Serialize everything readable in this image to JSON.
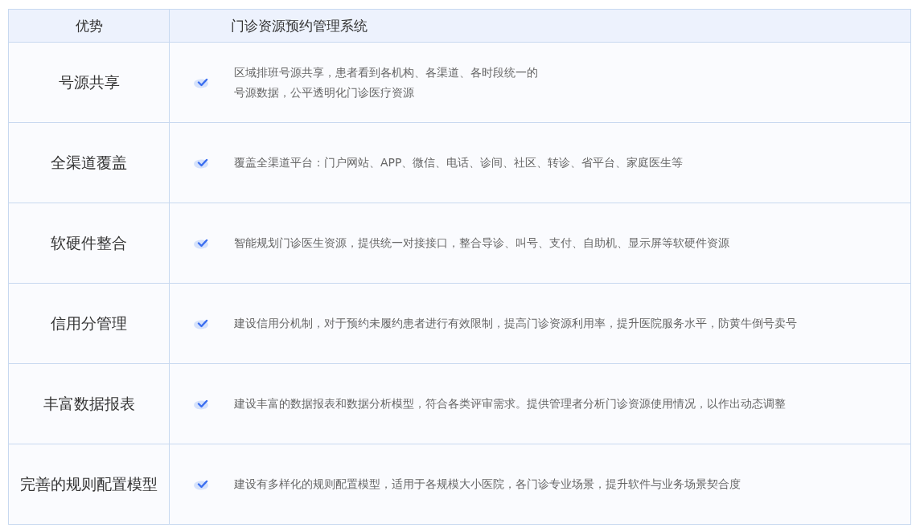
{
  "table": {
    "columns": [
      "优势",
      "门诊资源预约管理系统"
    ],
    "rows": [
      {
        "advantage": "号源共享",
        "lines": [
          "区域排班号源共享，患者看到各机构、各渠道、各时段统一的",
          "号源数据，公平透明化门诊医疗资源"
        ]
      },
      {
        "advantage": "全渠道覆盖",
        "lines": [
          "覆盖全渠道平台：门户网站、APP、微信、电话、诊间、社区、转诊、省平台、家庭医生等"
        ]
      },
      {
        "advantage": "软硬件整合",
        "lines": [
          "智能规划门诊医生资源，提供统一对接接口，整合导诊、叫号、支付、自助机、显示屏等软硬件资源"
        ]
      },
      {
        "advantage": "信用分管理",
        "lines": [
          "建设信用分机制，对于预约未履约患者进行有效限制，提高门诊资源利用率，提升医院服务水平，防黄牛倒号卖号"
        ]
      },
      {
        "advantage": "丰富数据报表",
        "lines": [
          "建设丰富的数据报表和数据分析模型，符合各类评审需求。提供管理者分析门诊资源使用情况，以作出动态调整"
        ]
      },
      {
        "advantage": "完善的规则配置模型",
        "lines": [
          "建设有多样化的规则配置模型，适用于各规模大小医院，各门诊专业场景，提升软件与业务场景契合度"
        ]
      }
    ]
  }
}
